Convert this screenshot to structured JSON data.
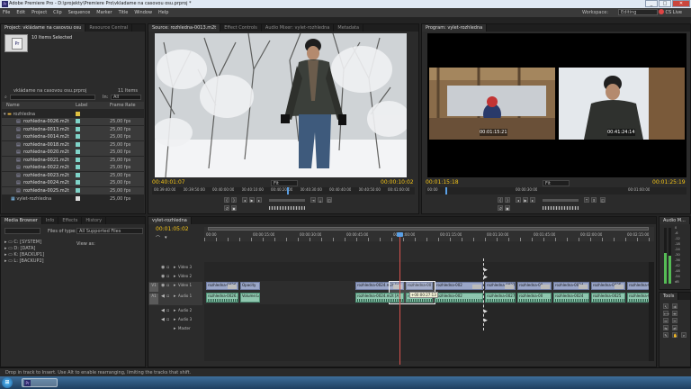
{
  "app": {
    "title": "Adobe Premiere Pro - D:\\projekty\\Premiere Pro\\vkladame na casovou osu.prproj *",
    "logo": "Pr"
  },
  "window_buttons": [
    "_",
    "□",
    "✕"
  ],
  "menu": [
    "File",
    "Edit",
    "Project",
    "Clip",
    "Sequence",
    "Marker",
    "Title",
    "Window",
    "Help"
  ],
  "workspace": {
    "label": "Workspace:",
    "value": "Editing"
  },
  "cslive": "CS Live",
  "project": {
    "tabs": [
      "Project: vkládame na casovou osu",
      "Resource Central"
    ],
    "selection": "10 Items Selected",
    "file": "vkládame na casovou osu.prproj",
    "count": "11 Items",
    "search_label": "In:",
    "search_value": "All",
    "cols": [
      "Name",
      "Label",
      "Frame Rate"
    ],
    "folder": "rozhledna",
    "items": [
      {
        "name": "rozhledna-0026.m2t",
        "fps": "25,00 fps"
      },
      {
        "name": "rozhledna-0013.m2t",
        "fps": "25,00 fps"
      },
      {
        "name": "rozhledna-0014.m2t",
        "fps": "25,00 fps"
      },
      {
        "name": "rozhledna-0018.m2t",
        "fps": "25,00 fps"
      },
      {
        "name": "rozhledna-0020.m2t",
        "fps": "25,00 fps"
      },
      {
        "name": "rozhledna-0021.m2t",
        "fps": "25,00 fps"
      },
      {
        "name": "rozhledna-0022.m2t",
        "fps": "25,00 fps"
      },
      {
        "name": "rozhledna-0023.m2t",
        "fps": "25,00 fps"
      },
      {
        "name": "rozhledna-0024.m2t",
        "fps": "25,00 fps"
      },
      {
        "name": "rozhledna-0025.m2t",
        "fps": "25,00 fps"
      }
    ],
    "sequence": "vylet-rozhledna",
    "sequence_fps": "25,00 fps"
  },
  "source": {
    "tabs": [
      "Source: rozhledna-0013.m2t",
      "Effect Controls",
      "Audio Mixer: vylet-rozhledna",
      "Metadata"
    ],
    "timecode_in": "00:40:01:07",
    "fit": "Fit",
    "timecode_dur": "00:00:10:02",
    "ruler": [
      "00:39:40:00",
      "00:39:50:00",
      "00:40:00:00",
      "00:40:10:00",
      "00:40:20:00",
      "00:40:30:00",
      "00:40:40:00",
      "00:40:50:00",
      "00:41:00:00"
    ]
  },
  "program": {
    "tabs": [
      "Program: vylet-rozhledna"
    ],
    "timecode_in": "00:01:15:18",
    "fit": "Fit",
    "timecode_dur": "00:01:25:19",
    "overlay_left": "00:01:15:21",
    "overlay_right": "00:41:24:14",
    "ruler": [
      "00:00",
      "00:00:30:00",
      "00:01:00:00"
    ]
  },
  "media": {
    "tabs": [
      "Media Browser",
      "Info",
      "Effects",
      "History"
    ],
    "files_label": "Files of type:",
    "files_value": "All Supported Files",
    "view_label": "View as:",
    "drives": [
      "C: [SYSTEM]",
      "D: [DATA]",
      "K: [BACKUP1]",
      "L: [BACKUP2]"
    ]
  },
  "timeline": {
    "tabs": [
      "vylet-rozhledna"
    ],
    "timecode": "00:01:05:02",
    "ruler": [
      "00:00",
      "00:00:15:00",
      "00:00:30:00",
      "00:00:45:00",
      "00:01:00:00",
      "00:01:15:00",
      "00:01:30:00",
      "00:01:45:00",
      "00:02:00:00",
      "00:02:15:00"
    ],
    "tracks": [
      "Video 3",
      "Video 2",
      "Video 1",
      "Audio 1",
      "Audio 2",
      "Audio 3",
      "Master"
    ],
    "v1_clips": [
      "rozhledna-0026.m2t [V]",
      "Opacity",
      "rozhledna-0026.m2t [V]",
      "rozhledna-0024.m2t [V]",
      "rozhledna-00",
      "rozhledna-002",
      "rozhledna-0027.m2t [V]",
      "rozhledna-00",
      "rozhledna-0024",
      "rozhledna-0",
      "rozhledna-0025",
      "rozhledna-0025.m2t [V]"
    ],
    "a1_clips": [
      "rozhledna-0026.m2t [A]",
      "Volume:Level",
      "rozhledna-0026.m2t [A]",
      "rozhledna-0024.m2t [A]",
      "rozhledna-00",
      "rozhledna-002",
      "rozhledna-0027.m2t [A]",
      "rozhledna-00",
      "rozhledna-0024",
      "rozhledna-0",
      "rozhledna-0025",
      "rozhledna-0025.m2t [A]"
    ],
    "tooltip": "+00:00:27:13"
  },
  "audio_meter": {
    "tab": "Audio M...",
    "labels": [
      "0",
      "-6",
      "-12",
      "-18",
      "-24",
      "-30",
      "-36",
      "-42",
      "-48",
      "-54",
      "dB"
    ],
    "levels": [
      0.55,
      0.5
    ]
  },
  "tools": {
    "tab": "Tools"
  },
  "status": "Drop in track to Insert. Use Alt to enable rearranging, limiting the tracks that shift.",
  "taskbar": {
    "start": "Start"
  },
  "colors": {
    "timecode": "#f5c518",
    "video_clip": "#9aa6c8",
    "audio_clip": "#8ec6ae",
    "playhead": "#d9534f",
    "label_violet": "#b9a9d9",
    "label_teal": "#7fd3c8"
  }
}
